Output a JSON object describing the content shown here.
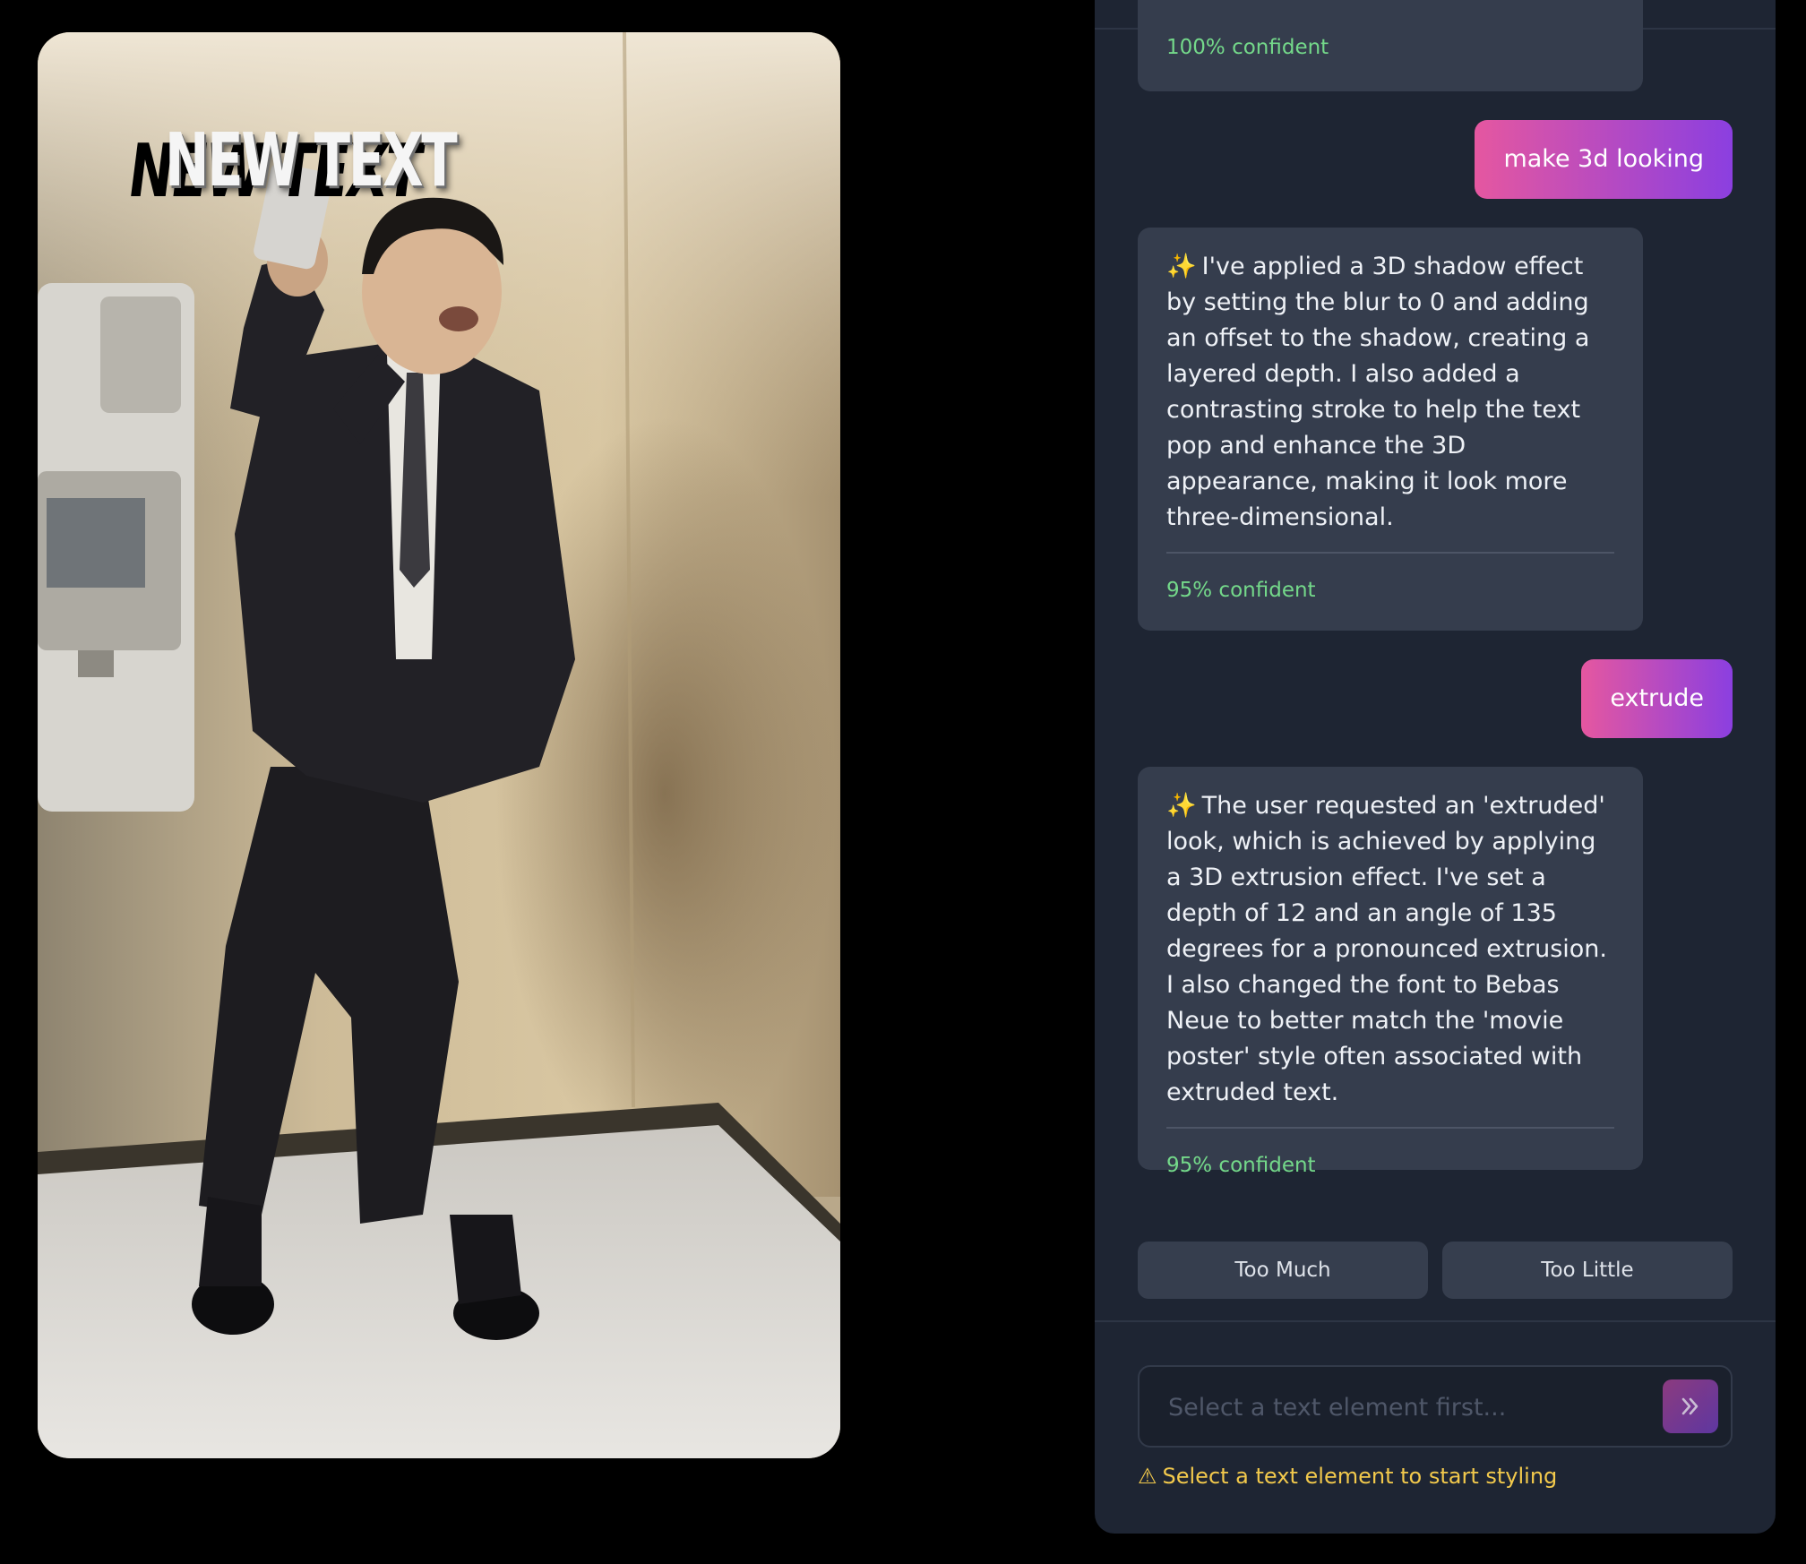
{
  "preview": {
    "overlay_text": "NEW TEXT"
  },
  "chat": {
    "top_bubble": {
      "confidence": "100% confident"
    },
    "messages": [
      {
        "role": "user",
        "text": "make 3d looking"
      },
      {
        "role": "assistant",
        "text": "I've applied a 3D shadow effect by setting the blur to 0 and adding an offset to the shadow, creating a layered depth. I also added a contrasting stroke to help the text pop and enhance the 3D appearance, making it look more three-dimensional.",
        "confidence": "95% confident"
      },
      {
        "role": "user",
        "text": "extrude"
      },
      {
        "role": "assistant",
        "text": "The user requested an 'extruded' look, which is achieved by applying a 3D extrusion effect. I've set a depth of 12 and an angle of 135 degrees for a pronounced extrusion. I also changed the font to Bebas Neue to better match the 'movie poster' style often associated with extruded text.",
        "confidence": "95% confident"
      }
    ],
    "quick_actions": {
      "too_much": "Too Much",
      "too_little": "Too Little"
    },
    "input": {
      "placeholder": "Select a text element first...",
      "value": ""
    },
    "warning": "Select a text element to start styling",
    "icons": {
      "sparkle": "sparkle-icon",
      "send": "double-chevron-right-icon",
      "warning": "warning-triangle-icon"
    },
    "colors": {
      "confidence": "#74d98a",
      "warning": "#f2c94c",
      "user_bubble_start": "#e557a0",
      "user_bubble_end": "#8b3fe0",
      "panel_bg": "#1e2533",
      "assistant_bubble": "#353d4d"
    }
  }
}
